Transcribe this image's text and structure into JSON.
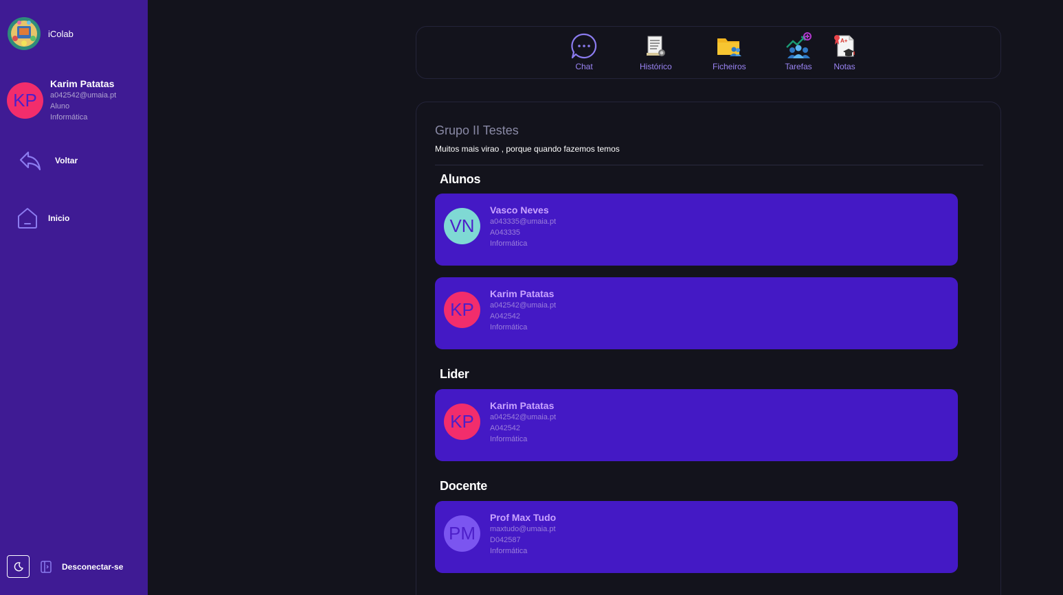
{
  "app": {
    "name": "iColab"
  },
  "user": {
    "initials": "KP",
    "name": "Karim Patatas",
    "email": "a042542@umaia.pt",
    "role": "Aluno",
    "course": "Informática",
    "avatar_color": "#f22d6c"
  },
  "nav": {
    "back_label": "Voltar",
    "home_label": "Inicio",
    "logout_label": "Desconectar-se"
  },
  "toolbar": {
    "items": [
      {
        "label": "Chat",
        "icon": "chat-bubble-icon"
      },
      {
        "label": "Histórico",
        "icon": "document-history-icon"
      },
      {
        "label": "Ficheiros",
        "icon": "folder-users-icon"
      },
      {
        "label": "Tarefas",
        "icon": "team-tasks-icon"
      },
      {
        "label": "Notas",
        "icon": "grade-report-icon"
      }
    ]
  },
  "group": {
    "title": "Grupo II Testes",
    "description": "Muitos mais virao , porque quando fazemos temos"
  },
  "sections": {
    "students_title": "Alunos",
    "leader_title": "Lider",
    "teacher_title": "Docente"
  },
  "students": [
    {
      "initials": "VN",
      "name": "Vasco Neves",
      "email": "a043335@umaia.pt",
      "number": "A043335",
      "course": "Informática",
      "avatar_color": "#7fd9d4"
    },
    {
      "initials": "KP",
      "name": "Karim Patatas",
      "email": "a042542@umaia.pt",
      "number": "A042542",
      "course": "Informática",
      "avatar_color": "#f22d6c"
    }
  ],
  "leader": {
    "initials": "KP",
    "name": "Karim Patatas",
    "email": "a042542@umaia.pt",
    "number": "A042542",
    "course": "Informática",
    "avatar_color": "#f22d6c"
  },
  "teacher": {
    "initials": "PM",
    "name": "Prof Max Tudo",
    "email": "maxtudo@umaia.pt",
    "number": "D042587",
    "course": "Informática",
    "avatar_color": "#7b55f0"
  },
  "colors": {
    "sidebar": "#3f1b94",
    "background": "#13131c",
    "card": "#4419c5",
    "accent": "#9b85f5"
  }
}
